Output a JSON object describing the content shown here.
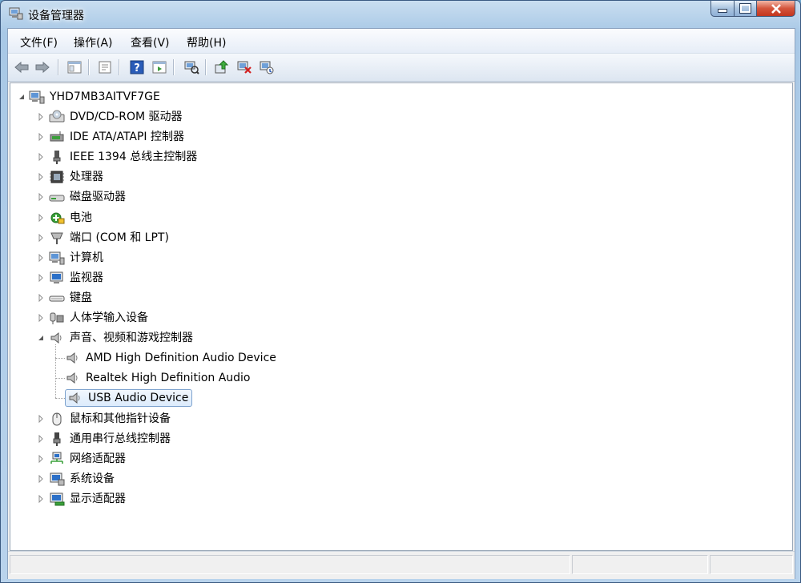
{
  "window": {
    "title": "设备管理器",
    "icon": "device-manager-icon"
  },
  "menu": [
    {
      "label": "文件(F)"
    },
    {
      "label": "操作(A)"
    },
    {
      "label": "查看(V)"
    },
    {
      "label": "帮助(H)"
    }
  ],
  "toolbar": [
    {
      "icon": "back-arrow-icon"
    },
    {
      "icon": "forward-arrow-icon"
    },
    {
      "icon": "show-hide-console-tree-icon"
    },
    {
      "icon": "properties-icon"
    },
    {
      "icon": "help-icon"
    },
    {
      "icon": "show-action-pane-icon"
    },
    {
      "icon": "scan-hardware-icon"
    },
    {
      "icon": "update-driver-icon"
    },
    {
      "icon": "uninstall-device-icon"
    },
    {
      "icon": "disable-device-icon"
    }
  ],
  "tree": {
    "root": {
      "label": "YHD7MB3AITVF7GE",
      "icon": "computer-icon"
    },
    "categories": [
      {
        "label": "DVD/CD-ROM 驱动器",
        "icon": "dvd-drive-icon"
      },
      {
        "label": "IDE ATA/ATAPI 控制器",
        "icon": "ide-controller-icon"
      },
      {
        "label": "IEEE 1394 总线主控制器",
        "icon": "ieee1394-icon"
      },
      {
        "label": "处理器",
        "icon": "processor-icon"
      },
      {
        "label": "磁盘驱动器",
        "icon": "disk-drive-icon"
      },
      {
        "label": "电池",
        "icon": "battery-icon"
      },
      {
        "label": "端口 (COM 和 LPT)",
        "icon": "port-icon"
      },
      {
        "label": "计算机",
        "icon": "computer-icon"
      },
      {
        "label": "监视器",
        "icon": "monitor-icon"
      },
      {
        "label": "键盘",
        "icon": "keyboard-icon"
      },
      {
        "label": "人体学输入设备",
        "icon": "hid-icon"
      },
      {
        "label": "声音、视频和游戏控制器",
        "icon": "speaker-icon"
      },
      {
        "label": "鼠标和其他指针设备",
        "icon": "mouse-icon"
      },
      {
        "label": "通用串行总线控制器",
        "icon": "usb-icon"
      },
      {
        "label": "网络适配器",
        "icon": "network-adapter-icon"
      },
      {
        "label": "系统设备",
        "icon": "system-device-icon"
      },
      {
        "label": "显示适配器",
        "icon": "display-adapter-icon"
      }
    ],
    "sound_children": [
      {
        "label": "AMD High Definition Audio Device",
        "icon": "speaker-icon"
      },
      {
        "label": "Realtek High Definition Audio",
        "icon": "speaker-icon"
      },
      {
        "label": "USB Audio Device",
        "icon": "speaker-icon",
        "selected": true
      }
    ]
  }
}
